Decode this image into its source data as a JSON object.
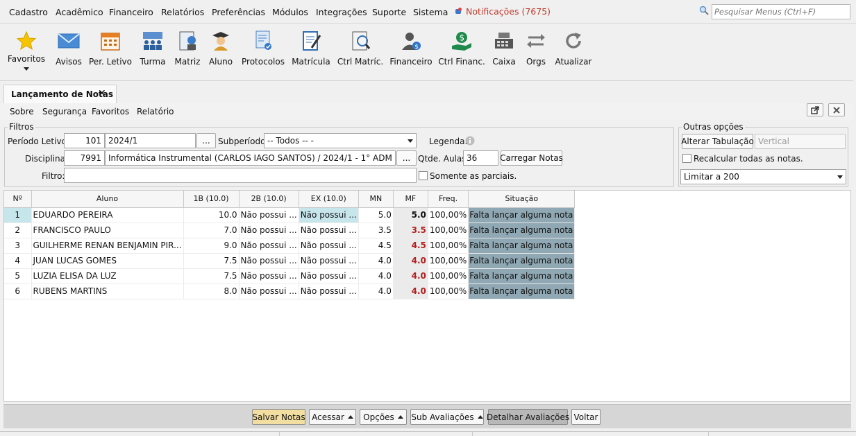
{
  "menubar": {
    "items": [
      "Cadastro",
      "Acadêmico",
      "Financeiro",
      "Relatórios",
      "Preferências",
      "Módulos",
      "Integrações",
      "Suporte",
      "Sistema"
    ],
    "notifications": "Notificações (7675)",
    "search_placeholder": "Pesquisar Menus (Ctrl+F)"
  },
  "toolbar": {
    "items": [
      "Favoritos",
      "Avisos",
      "Per. Letivo",
      "Turma",
      "Matriz",
      "Aluno",
      "Protocolos",
      "Matrícula",
      "Ctrl Matríc.",
      "Financeiro",
      "Ctrl Financ.",
      "Caixa",
      "Orgs",
      "Atualizar"
    ]
  },
  "tab": {
    "title": "Lançamento de Notas",
    "close": "✕"
  },
  "submenu": {
    "items": [
      "Sobre",
      "Segurança",
      "Favoritos",
      "Relatório"
    ]
  },
  "filters": {
    "legend": "Filtros",
    "periodo_label": "Período Letivo:",
    "periodo_code": "101",
    "periodo_name": "2024/1",
    "browse": "...",
    "subperiodo_label": "Subperíodo:",
    "subperiodo_value": "-- Todos -- -",
    "legenda_label": "Legenda:",
    "disciplina_label": "Disciplina:",
    "disciplina_code": "7991",
    "disciplina_name": "Informática Instrumental (CARLOS IAGO SANTOS) / 2024/1 - 1° ADM",
    "qtde_label": "Qtde. Aulas:",
    "qtde_value": "36",
    "carregar": "Carregar Notas",
    "filtro_label": "Filtro:",
    "filtro_value": "",
    "parciais_label": "Somente as parciais."
  },
  "outras": {
    "legend": "Outras opções",
    "alterar": "Alterar Tabulação",
    "vertical_placeholder": "Vertical",
    "recalcular": "Recalcular todas as notas.",
    "limitar": "Limitar a 200"
  },
  "grid": {
    "headers": [
      "Nº",
      "Aluno",
      "1B (10.0)",
      "2B (10.0)",
      "EX (10.0)",
      "MN",
      "MF",
      "Freq.",
      "Situação"
    ],
    "rows": [
      {
        "n": "1",
        "aluno": "EDUARDO PEREIRA",
        "b1": "10.0",
        "b2": "Não possui ...",
        "ex": "Não possui ...",
        "mn": "5.0",
        "mf": "5.0",
        "mf_color": "#111111",
        "freq": "100,00%",
        "sit": "Falta lançar alguma nota"
      },
      {
        "n": "2",
        "aluno": "FRANCISCO PAULO",
        "b1": "7.0",
        "b2": "Não possui ...",
        "ex": "Não possui ...",
        "mn": "3.5",
        "mf": "3.5",
        "mf_color": "#b22222",
        "freq": "100,00%",
        "sit": "Falta lançar alguma nota"
      },
      {
        "n": "3",
        "aluno": "GUILHERME RENAN BENJAMIN PIR...",
        "b1": "9.0",
        "b2": "Não possui ...",
        "ex": "Não possui ...",
        "mn": "4.5",
        "mf": "4.5",
        "mf_color": "#b22222",
        "freq": "100,00%",
        "sit": "Falta lançar alguma nota"
      },
      {
        "n": "4",
        "aluno": "JUAN LUCAS GOMES",
        "b1": "7.5",
        "b2": "Não possui ...",
        "ex": "Não possui ...",
        "mn": "4.0",
        "mf": "4.0",
        "mf_color": "#b22222",
        "freq": "100,00%",
        "sit": "Falta lançar alguma nota"
      },
      {
        "n": "5",
        "aluno": "LUZIA ELISA DA LUZ",
        "b1": "7.5",
        "b2": "Não possui ...",
        "ex": "Não possui ...",
        "mn": "4.0",
        "mf": "4.0",
        "mf_color": "#b22222",
        "freq": "100,00%",
        "sit": "Falta lançar alguma nota"
      },
      {
        "n": "6",
        "aluno": "RUBENS MARTINS",
        "b1": "8.0",
        "b2": "Não possui ...",
        "ex": "Não possui ...",
        "mn": "4.0",
        "mf": "4.0",
        "mf_color": "#b22222",
        "freq": "100,00%",
        "sit": "Falta lançar alguma nota"
      }
    ]
  },
  "bottom": {
    "salvar": "Salvar Notas",
    "acessar": "Acessar",
    "opcoes": "Opções",
    "sub": "Sub Avaliações",
    "detalhar": "Detalhar Avaliações",
    "voltar": "Voltar"
  },
  "colors": {
    "salvar_bg": "#f1dea0",
    "detalhar_bg": "#b8b8b8",
    "situacao_bg": "#8fa8b3",
    "notif": "#c0392b"
  }
}
